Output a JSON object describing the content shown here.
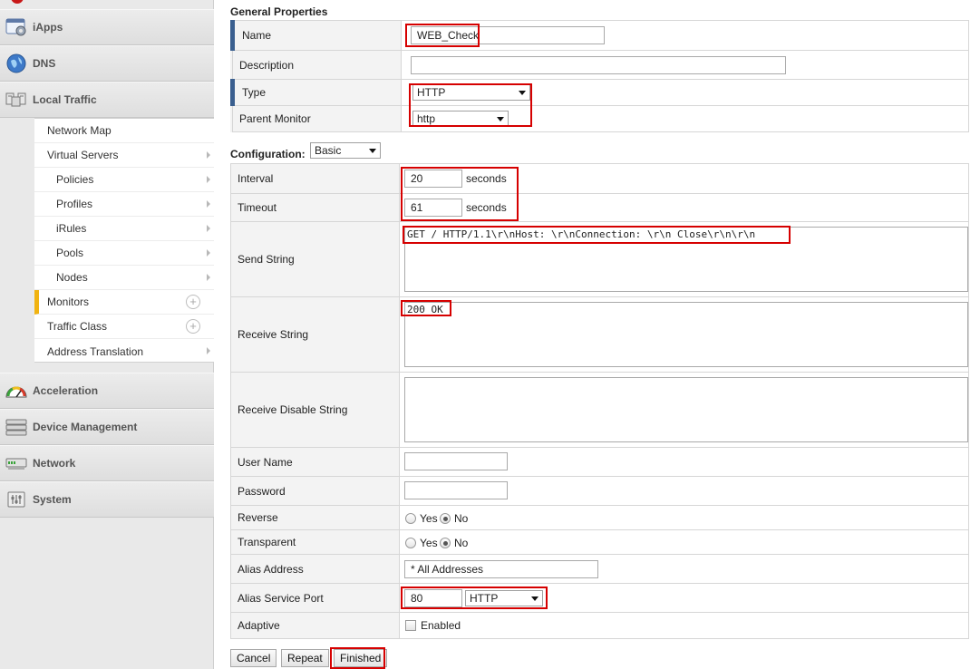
{
  "nav": {
    "sections": [
      {
        "label": "iApps",
        "icon": "iapps-icon"
      },
      {
        "label": "DNS",
        "icon": "globe-icon"
      },
      {
        "label": "Local Traffic",
        "icon": "local-traffic-icon"
      },
      {
        "label": "Acceleration",
        "icon": "gauge-icon"
      },
      {
        "label": "Device Management",
        "icon": "device-icon"
      },
      {
        "label": "Network",
        "icon": "network-icon"
      },
      {
        "label": "System",
        "icon": "system-icon"
      }
    ],
    "local_traffic_items": [
      {
        "label": "Network Map"
      },
      {
        "label": "Virtual Servers"
      },
      {
        "label": "Policies"
      },
      {
        "label": "Profiles"
      },
      {
        "label": "iRules"
      },
      {
        "label": "Pools"
      },
      {
        "label": "Nodes"
      },
      {
        "label": "Monitors"
      },
      {
        "label": "Traffic Class"
      },
      {
        "label": "Address Translation"
      }
    ],
    "active_item": "Monitors",
    "plus_symbol": "+"
  },
  "general": {
    "title": "General Properties",
    "name_label": "Name",
    "name_value": "WEB_Check",
    "description_label": "Description",
    "description_value": "",
    "type_label": "Type",
    "type_value": "HTTP",
    "parent_label": "Parent Monitor",
    "parent_value": "http"
  },
  "config": {
    "title": "Configuration:",
    "mode": "Basic",
    "interval_label": "Interval",
    "interval_value": "20",
    "timeout_label": "Timeout",
    "timeout_value": "61",
    "unit_seconds": "seconds",
    "send_label": "Send String",
    "send_value": "GET / HTTP/1.1\\r\\nHost: \\r\\nConnection: \\r\\n Close\\r\\n\\r\\n",
    "receive_label": "Receive String",
    "receive_value": "200 OK",
    "receive_disable_label": "Receive Disable String",
    "receive_disable_value": "",
    "username_label": "User Name",
    "username_value": "",
    "password_label": "Password",
    "password_value": "",
    "reverse_label": "Reverse",
    "transparent_label": "Transparent",
    "yes": "Yes",
    "no": "No",
    "alias_address_label": "Alias Address",
    "alias_address_value": "* All Addresses",
    "alias_port_label": "Alias Service Port",
    "alias_port_value": "80",
    "alias_port_service": "HTTP",
    "adaptive_label": "Adaptive",
    "adaptive_enabled_label": "Enabled"
  },
  "buttons": {
    "cancel": "Cancel",
    "repeat": "Repeat",
    "finished": "Finished"
  },
  "colors": {
    "highlight": "#d60000",
    "required_marker": "#3a5f8f",
    "active_marker": "#f1b310"
  }
}
